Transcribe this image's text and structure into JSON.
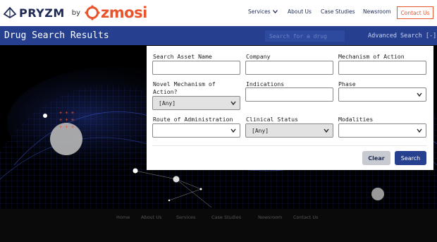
{
  "brand": {
    "product": "PRYZM",
    "by": "by",
    "company": "zmosi",
    "colors": {
      "navy": "#1e2a55",
      "orange": "#e8542c",
      "blue": "#26408f"
    }
  },
  "header": {
    "nav": {
      "services": "Services",
      "about": "About Us",
      "case_studies": "Case Studies",
      "newsroom": "Newsroom"
    },
    "contact_button": "Contact Us"
  },
  "titlebar": {
    "title": "Drug Search Results",
    "search_placeholder": "Search for a drug",
    "advanced_search": "Advanced Search [-]"
  },
  "form": {
    "search_asset_name": {
      "label": "Search Asset Name",
      "value": ""
    },
    "company": {
      "label": "Company",
      "value": ""
    },
    "mechanism": {
      "label": "Mechanism of Action",
      "value": ""
    },
    "novel_mechanism": {
      "label_line1": "Novel Mechanism of",
      "label_line2": "Action?",
      "value": "[Any]"
    },
    "indications": {
      "label": "Indications",
      "value": ""
    },
    "phase": {
      "label": "Phase",
      "value": ""
    },
    "route": {
      "label": "Route of Administration",
      "value": ""
    },
    "clinical_status": {
      "label": "Clinical Status",
      "value": "[Any]"
    },
    "modalities": {
      "label": "Modalities",
      "value": ""
    },
    "clear_button": "Clear",
    "search_button": "Search"
  },
  "footer": {
    "links": [
      "Home",
      "About Us",
      "Services",
      "Case Studies",
      "Newsroom",
      "Contact Us"
    ]
  }
}
